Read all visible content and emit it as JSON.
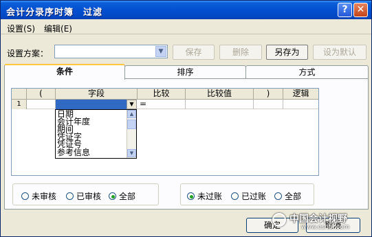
{
  "window": {
    "title": "会计分录序时簿　过滤"
  },
  "titlebar": {
    "help_label": "?",
    "close_label": "✕"
  },
  "menu": [
    {
      "label": "设置",
      "key": "(S)"
    },
    {
      "label": "编辑",
      "key": "(E)"
    }
  ],
  "scheme": {
    "label": "设置方案：",
    "value": ""
  },
  "toolbar": {
    "save": "保存",
    "delete": "删除",
    "save_as": "另存为",
    "set_default": "设为默认"
  },
  "tabs": [
    {
      "label": "条件",
      "active": true
    },
    {
      "label": "排序",
      "active": false
    },
    {
      "label": "方式",
      "active": false
    }
  ],
  "grid": {
    "headers": [
      "",
      "(",
      "字段",
      "比较",
      "比较值",
      ")",
      "逻辑"
    ],
    "row": {
      "num": "1",
      "compare": "="
    }
  },
  "dropdown": {
    "items": [
      "日期",
      "会计年度",
      "期间",
      "凭证字",
      "凭证号",
      "参考信息"
    ]
  },
  "audit_group": [
    {
      "label": "未审核",
      "checked": false
    },
    {
      "label": "已审核",
      "checked": false
    },
    {
      "label": "全部",
      "checked": true
    }
  ],
  "post_group": [
    {
      "label": "未过账",
      "checked": true
    },
    {
      "label": "已过账",
      "checked": false
    },
    {
      "label": "全部",
      "checked": false
    }
  ],
  "footer": {
    "ok": "确定",
    "cancel": "取消"
  },
  "watermark": {
    "text": "中国会计视野",
    "url": "www.esnai.com"
  }
}
